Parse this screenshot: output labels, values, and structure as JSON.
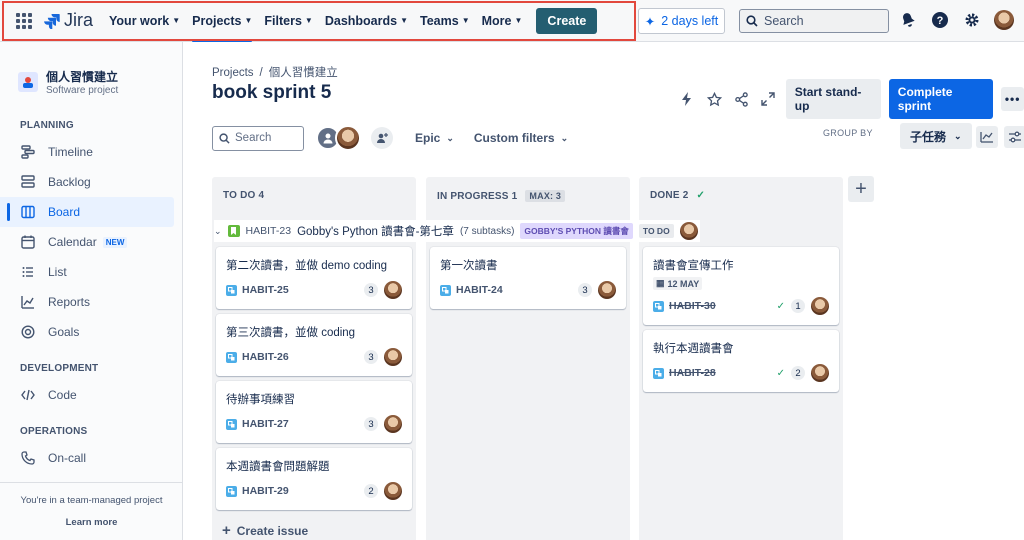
{
  "topbar": {
    "logo": "Jira",
    "nav": [
      {
        "label": "Your work"
      },
      {
        "label": "Projects"
      },
      {
        "label": "Filters"
      },
      {
        "label": "Dashboards"
      },
      {
        "label": "Teams"
      },
      {
        "label": "More"
      }
    ],
    "create": "Create",
    "trial": "2 days left",
    "search_placeholder": "Search"
  },
  "sidebar": {
    "project_name": "個人習慣建立",
    "project_type": "Software project",
    "planning_label": "PLANNING",
    "planning": [
      {
        "label": "Timeline",
        "icon": "timeline-icon"
      },
      {
        "label": "Backlog",
        "icon": "backlog-icon"
      },
      {
        "label": "Board",
        "icon": "board-icon",
        "active": true
      },
      {
        "label": "Calendar",
        "icon": "calendar-icon",
        "badge": "NEW"
      },
      {
        "label": "List",
        "icon": "list-icon"
      },
      {
        "label": "Reports",
        "icon": "reports-icon"
      },
      {
        "label": "Goals",
        "icon": "goals-icon"
      }
    ],
    "development_label": "DEVELOPMENT",
    "development": [
      {
        "label": "Code",
        "icon": "code-icon"
      }
    ],
    "operations_label": "OPERATIONS",
    "operations": [
      {
        "label": "On-call",
        "icon": "on-call-icon"
      }
    ],
    "footer_text": "You're in a team-managed project",
    "learn_more": "Learn more"
  },
  "main": {
    "breadcrumb": {
      "root": "Projects",
      "sep": "/",
      "project": "個人習慣建立"
    },
    "title": "book sprint 5",
    "start_standup": "Start stand-up",
    "complete_sprint": "Complete sprint",
    "more": "•••",
    "search_placeholder": "Search",
    "epic_filter": "Epic",
    "custom_filters": "Custom filters",
    "group_by_label": "GROUP BY",
    "group_by_value": "子任務"
  },
  "columns": [
    {
      "name": "TO DO",
      "count": "4"
    },
    {
      "name": "IN PROGRESS",
      "count": "1",
      "max": "MAX: 3"
    },
    {
      "name": "DONE",
      "count": "2"
    }
  ],
  "swimlane": {
    "key": "HABIT-23",
    "title": "Gobby's Python 讀書會-第七章",
    "subtasks": "(7 subtasks)",
    "epic": "GOBBY'S PYTHON 讀書會",
    "status": "TO DO"
  },
  "cards": {
    "todo": [
      {
        "title": "第二次讀書，並做 demo coding",
        "key": "HABIT-25",
        "count": "3"
      },
      {
        "title": "第三次讀書，並做 coding",
        "key": "HABIT-26",
        "count": "3"
      },
      {
        "title": "待辦事項練習",
        "key": "HABIT-27",
        "count": "3"
      },
      {
        "title": "本週讀書會問題解題",
        "key": "HABIT-29",
        "count": "2"
      }
    ],
    "inprogress": [
      {
        "title": "第一次讀書",
        "key": "HABIT-24",
        "count": "3"
      }
    ],
    "done": [
      {
        "title": "讀書會宣傳工作",
        "key": "HABIT-30",
        "count": "1",
        "date": "12 MAY"
      },
      {
        "title": "執行本週讀書會",
        "key": "HABIT-28",
        "count": "2"
      }
    ]
  },
  "create_issue": "Create issue"
}
